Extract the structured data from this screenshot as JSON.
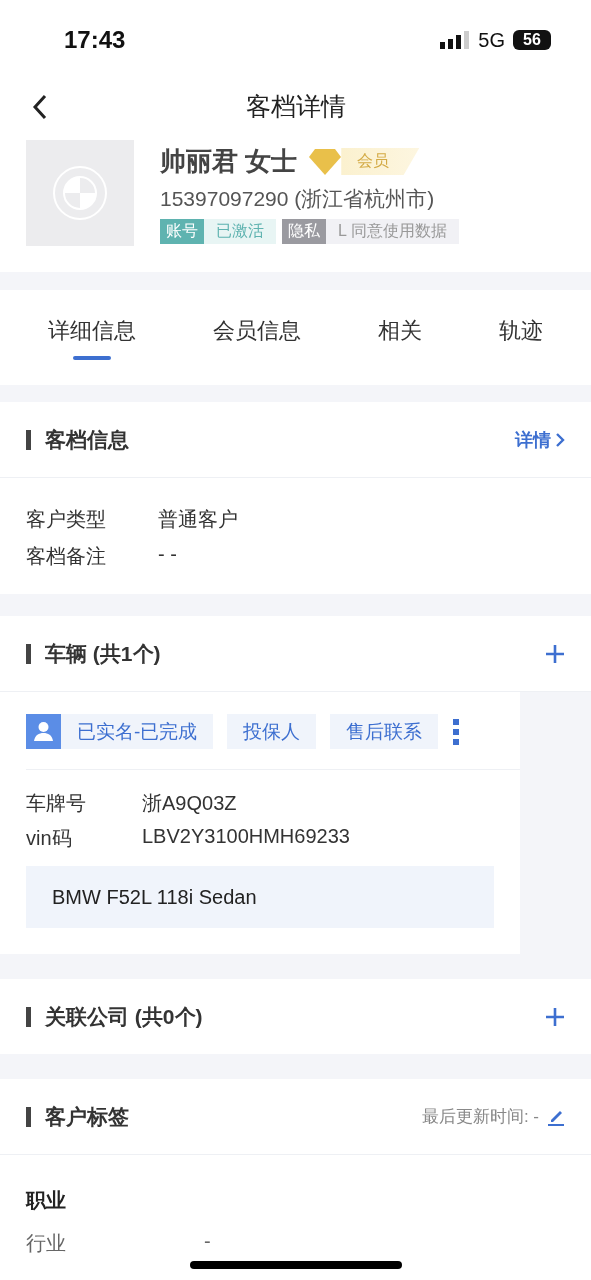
{
  "status_bar": {
    "time": "17:43",
    "network": "5G",
    "battery": "56"
  },
  "nav": {
    "title": "客档详情"
  },
  "profile": {
    "name": "帅丽君 女士",
    "badge": "会员",
    "phone": "15397097290 (浙江省杭州市)",
    "tags": [
      {
        "kind": "account",
        "label": "账号",
        "value": "已激活"
      },
      {
        "kind": "privacy",
        "label": "隐私",
        "value": "L 同意使用数据"
      }
    ]
  },
  "tabs": [
    {
      "label": "详细信息",
      "selected": true
    },
    {
      "label": "会员信息",
      "selected": false
    },
    {
      "label": "相关",
      "selected": false
    },
    {
      "label": "轨迹",
      "selected": false
    }
  ],
  "archive": {
    "title": "客档信息",
    "link": "详情",
    "fields": [
      {
        "label": "客户类型",
        "value": "普通客户"
      },
      {
        "label": "客档备注",
        "value": "- -"
      }
    ]
  },
  "vehicles": {
    "title": "车辆",
    "count": "(共1个)",
    "roles": [
      {
        "kind": "person",
        "label": "已实名-已完成"
      },
      {
        "kind": "plain",
        "label": "投保人"
      },
      {
        "kind": "plain",
        "label": "售后联系"
      }
    ],
    "fields": [
      {
        "label": "车牌号",
        "value": "浙A9Q03Z"
      },
      {
        "label": "vin码",
        "value": "LBV2Y3100HMH69233"
      }
    ],
    "model": "BMW F52L 118i Sedan"
  },
  "companies": {
    "title": "关联公司",
    "count": "(共0个)"
  },
  "labels": {
    "title": "客户标签",
    "updated": "最后更新时间:  -",
    "group": "职业",
    "rows": [
      {
        "label": "行业",
        "value": "-"
      }
    ]
  }
}
